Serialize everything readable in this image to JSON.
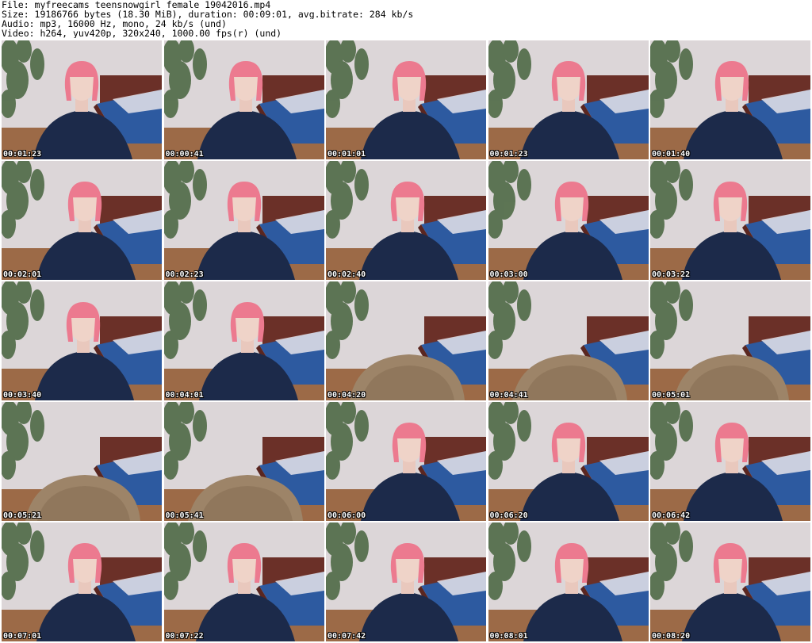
{
  "header": {
    "file_line": "File: myfreecams_teensnowgirl_female_19042016.mp4",
    "size_line": "Size: 19186766 bytes (18.30 MiB), duration: 00:09:01, avg.bitrate: 284 kb/s",
    "audio_line": "Audio: mp3, 16000 Hz, mono, 24 kb/s (und)",
    "video_line": "Video: h264, yuv420p, 320x240, 1000.00 fps(r) (und)"
  },
  "frames": [
    {
      "timestamp": "00:01:23",
      "subject": "person"
    },
    {
      "timestamp": "00:00:41",
      "subject": "person"
    },
    {
      "timestamp": "00:01:01",
      "subject": "person"
    },
    {
      "timestamp": "00:01:23",
      "subject": "person"
    },
    {
      "timestamp": "00:01:40",
      "subject": "person"
    },
    {
      "timestamp": "00:02:01",
      "subject": "person"
    },
    {
      "timestamp": "00:02:23",
      "subject": "person"
    },
    {
      "timestamp": "00:02:40",
      "subject": "person"
    },
    {
      "timestamp": "00:03:00",
      "subject": "person"
    },
    {
      "timestamp": "00:03:22",
      "subject": "person"
    },
    {
      "timestamp": "00:03:40",
      "subject": "person"
    },
    {
      "timestamp": "00:04:01",
      "subject": "person"
    },
    {
      "timestamp": "00:04:20",
      "subject": "chair"
    },
    {
      "timestamp": "00:04:41",
      "subject": "chair"
    },
    {
      "timestamp": "00:05:01",
      "subject": "chair"
    },
    {
      "timestamp": "00:05:21",
      "subject": "chair"
    },
    {
      "timestamp": "00:05:41",
      "subject": "chair"
    },
    {
      "timestamp": "00:06:00",
      "subject": "person"
    },
    {
      "timestamp": "00:06:20",
      "subject": "person"
    },
    {
      "timestamp": "00:06:42",
      "subject": "person"
    },
    {
      "timestamp": "00:07:01",
      "subject": "person"
    },
    {
      "timestamp": "00:07:22",
      "subject": "person"
    },
    {
      "timestamp": "00:07:42",
      "subject": "person"
    },
    {
      "timestamp": "00:08:01",
      "subject": "person"
    },
    {
      "timestamp": "00:08:20",
      "subject": "person"
    }
  ]
}
